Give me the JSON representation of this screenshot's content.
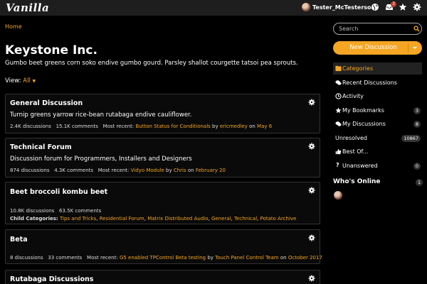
{
  "header": {
    "logo": "Vanilla",
    "username": "Tester_McTesterson",
    "notifications_count": "3"
  },
  "breadcrumb": "Home",
  "page": {
    "title": "Keystone Inc.",
    "description": "Gumbo beet greens corn soko endive gumbo gourd. Parsley shallot courgette tatsoi pea sprouts.",
    "view_label": "View:",
    "view_value": "All"
  },
  "categories": [
    {
      "title": "General Discussion",
      "description": "Turnip greens yarrow rice-bean rutabaga endive cauliflower.",
      "discussions": "2.4K discussions",
      "comments": "15.1K comments",
      "recent_label": "Most recent:",
      "recent_title": "Button Status for Conditionals",
      "by": "by",
      "recent_user": "ericmedley",
      "on": "on",
      "recent_date": "May 6"
    },
    {
      "title": "Technical Forum",
      "description": "Discussion forum for Programmers, Installers and Designers",
      "discussions": "874 discussions",
      "comments": "4.3K comments",
      "recent_label": "Most recent:",
      "recent_title": "Vidyo Module",
      "by": "by",
      "recent_user": "Chris",
      "on": "on",
      "recent_date": "February 20"
    },
    {
      "title": "Beet broccoli kombu beet",
      "discussions": "10.8K discussions",
      "comments": "63.5K comments",
      "child_label": "Child Categories:",
      "children": [
        "Tips and Tricks",
        "Residential Forum",
        "Matrix Distributed Audio",
        "General",
        "Technical",
        "Potato Archive"
      ]
    },
    {
      "title": "Beta",
      "discussions": "8 discussions",
      "comments": "33 comments",
      "recent_label": "Most recent:",
      "recent_title": "G5 enabled TPControl Beta testing",
      "by": "by",
      "recent_user": "Touch Panel Control Team",
      "on": "on",
      "recent_date": "October 2017"
    },
    {
      "title": "Rutabaga Discussions"
    }
  ],
  "sidebar": {
    "search_placeholder": "Search",
    "new_discussion": "New Discussion",
    "nav": [
      {
        "label": "Categories",
        "icon": "list-icon",
        "count": ""
      },
      {
        "label": "Recent Discussions",
        "icon": "chat-bubbles-icon",
        "count": ""
      },
      {
        "label": "Activity",
        "icon": "clock-icon",
        "count": ""
      },
      {
        "label": "My Bookmarks",
        "icon": "star-icon",
        "count": "3"
      },
      {
        "label": "My Discussions",
        "icon": "chat-bubbles-icon",
        "count": "8"
      },
      {
        "label": "Unresolved",
        "icon": "",
        "count": "10867"
      },
      {
        "label": "Best Of...",
        "icon": "thumbs-up-icon",
        "count": ""
      },
      {
        "label": "Unanswered",
        "icon": "question-icon",
        "count": "0"
      }
    ],
    "whos_online": "Who's Online",
    "online_count": "1"
  },
  "colors": {
    "accent": "#f5a623",
    "background": "#000000",
    "topbar": "#1e1e1e"
  }
}
